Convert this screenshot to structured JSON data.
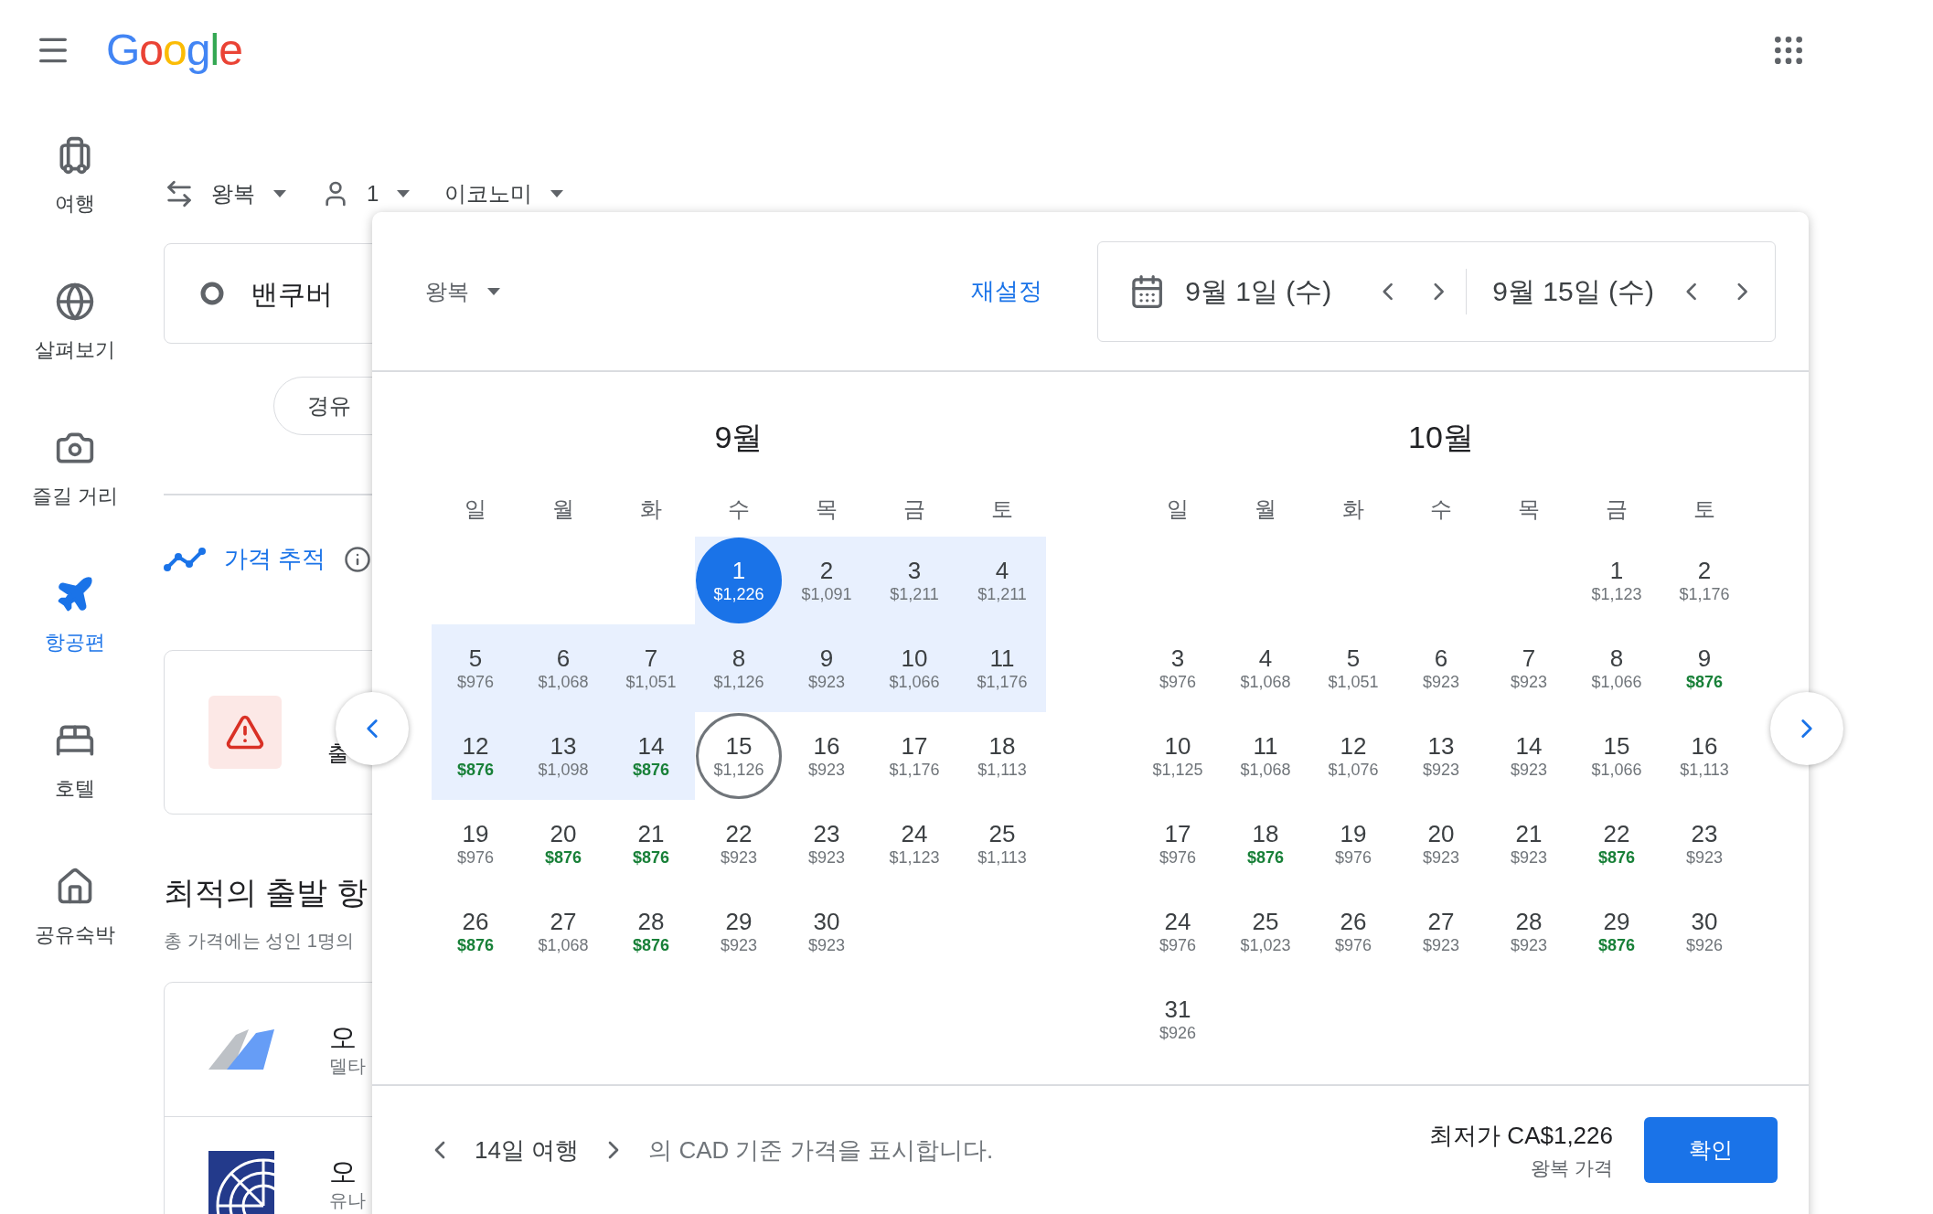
{
  "logo": "Google",
  "rail": [
    {
      "label": "여행",
      "selected": false
    },
    {
      "label": "살펴보기",
      "selected": false
    },
    {
      "label": "즐길 거리",
      "selected": false
    },
    {
      "label": "항공편",
      "selected": true
    },
    {
      "label": "호텔",
      "selected": false
    },
    {
      "label": "공유숙박",
      "selected": false
    }
  ],
  "trip_bar": {
    "trip_type": "왕복",
    "passengers": "1",
    "cabin": "이코노미"
  },
  "origin": "밴쿠버",
  "stops_chip": "경유",
  "price_tracking": "가격 추적",
  "alert_card": {
    "subtitle": "출"
  },
  "best_heading": "최적의 출발 항",
  "best_note": "총 가격에는 성인 1명의",
  "flights": [
    {
      "time": "오",
      "airline": "델타"
    },
    {
      "time": "오",
      "airline": "유나"
    }
  ],
  "picker": {
    "trip_type": "왕복",
    "reset": "재설정",
    "depart": "9월 1일 (수)",
    "return": "9월 15일 (수)",
    "months": [
      {
        "title": "9월",
        "weekdays": [
          "일",
          "월",
          "화",
          "수",
          "목",
          "금",
          "토"
        ],
        "weeks": [
          [
            {
              "day": "1",
              "price": "$1,226",
              "cheap": false,
              "selected": true,
              "in_range": true
            },
            {
              "day": "2",
              "price": "$1,091",
              "cheap": false,
              "selected": false,
              "in_range": true
            },
            {
              "day": "3",
              "price": "$1,211",
              "cheap": false,
              "selected": false,
              "in_range": true
            },
            {
              "day": "4",
              "price": "$1,211",
              "cheap": false,
              "selected": false,
              "in_range": true
            }
          ],
          [
            {
              "day": "5",
              "price": "$976",
              "cheap": false,
              "selected": false,
              "in_range": true
            },
            {
              "day": "6",
              "price": "$1,068",
              "cheap": false,
              "selected": false,
              "in_range": true
            },
            {
              "day": "7",
              "price": "$1,051",
              "cheap": false,
              "selected": false,
              "in_range": true
            },
            {
              "day": "8",
              "price": "$1,126",
              "cheap": false,
              "selected": false,
              "in_range": true
            },
            {
              "day": "9",
              "price": "$923",
              "cheap": false,
              "selected": false,
              "in_range": true
            },
            {
              "day": "10",
              "price": "$1,066",
              "cheap": false,
              "selected": false,
              "in_range": true
            },
            {
              "day": "11",
              "price": "$1,176",
              "cheap": false,
              "selected": false,
              "in_range": true
            }
          ],
          [
            {
              "day": "12",
              "price": "$876",
              "cheap": true,
              "selected": false,
              "in_range": true
            },
            {
              "day": "13",
              "price": "$1,098",
              "cheap": false,
              "selected": false,
              "in_range": true
            },
            {
              "day": "14",
              "price": "$876",
              "cheap": true,
              "selected": false,
              "in_range": true
            },
            {
              "day": "15",
              "price": "$1,126",
              "cheap": false,
              "selected": true,
              "in_range": false
            },
            {
              "day": "16",
              "price": "$923",
              "cheap": false,
              "selected": false,
              "in_range": false
            },
            {
              "day": "17",
              "price": "$1,176",
              "cheap": false,
              "selected": false,
              "in_range": false
            },
            {
              "day": "18",
              "price": "$1,113",
              "cheap": false,
              "selected": false,
              "in_range": false
            }
          ],
          [
            {
              "day": "19",
              "price": "$976",
              "cheap": false,
              "selected": false,
              "in_range": false
            },
            {
              "day": "20",
              "price": "$876",
              "cheap": true,
              "selected": false,
              "in_range": false
            },
            {
              "day": "21",
              "price": "$876",
              "cheap": true,
              "selected": false,
              "in_range": false
            },
            {
              "day": "22",
              "price": "$923",
              "cheap": false,
              "selected": false,
              "in_range": false
            },
            {
              "day": "23",
              "price": "$923",
              "cheap": false,
              "selected": false,
              "in_range": false
            },
            {
              "day": "24",
              "price": "$1,123",
              "cheap": false,
              "selected": false,
              "in_range": false
            },
            {
              "day": "25",
              "price": "$1,113",
              "cheap": false,
              "selected": false,
              "in_range": false
            }
          ],
          [
            {
              "day": "26",
              "price": "$876",
              "cheap": true,
              "selected": false,
              "in_range": false
            },
            {
              "day": "27",
              "price": "$1,068",
              "cheap": false,
              "selected": false,
              "in_range": false
            },
            {
              "day": "28",
              "price": "$876",
              "cheap": true,
              "selected": false,
              "in_range": false
            },
            {
              "day": "29",
              "price": "$923",
              "cheap": false,
              "selected": false,
              "in_range": false
            },
            {
              "day": "30",
              "price": "$923",
              "cheap": false,
              "selected": false,
              "in_range": false
            }
          ]
        ]
      },
      {
        "title": "10월",
        "weekdays": [
          "일",
          "월",
          "화",
          "수",
          "목",
          "금",
          "토"
        ],
        "weeks": [
          [
            {
              "day": "1",
              "price": "$1,123",
              "cheap": false,
              "selected": false,
              "in_range": false
            },
            {
              "day": "2",
              "price": "$1,176",
              "cheap": false,
              "selected": false,
              "in_range": false
            }
          ],
          [
            {
              "day": "3",
              "price": "$976",
              "cheap": false,
              "selected": false,
              "in_range": false
            },
            {
              "day": "4",
              "price": "$1,068",
              "cheap": false,
              "selected": false,
              "in_range": false
            },
            {
              "day": "5",
              "price": "$1,051",
              "cheap": false,
              "selected": false,
              "in_range": false
            },
            {
              "day": "6",
              "price": "$923",
              "cheap": false,
              "selected": false,
              "in_range": false
            },
            {
              "day": "7",
              "price": "$923",
              "cheap": false,
              "selected": false,
              "in_range": false
            },
            {
              "day": "8",
              "price": "$1,066",
              "cheap": false,
              "selected": false,
              "in_range": false
            },
            {
              "day": "9",
              "price": "$876",
              "cheap": true,
              "selected": false,
              "in_range": false
            }
          ],
          [
            {
              "day": "10",
              "price": "$1,125",
              "cheap": false,
              "selected": false,
              "in_range": false
            },
            {
              "day": "11",
              "price": "$1,068",
              "cheap": false,
              "selected": false,
              "in_range": false
            },
            {
              "day": "12",
              "price": "$1,076",
              "cheap": false,
              "selected": false,
              "in_range": false
            },
            {
              "day": "13",
              "price": "$923",
              "cheap": false,
              "selected": false,
              "in_range": false
            },
            {
              "day": "14",
              "price": "$923",
              "cheap": false,
              "selected": false,
              "in_range": false
            },
            {
              "day": "15",
              "price": "$1,066",
              "cheap": false,
              "selected": false,
              "in_range": false
            },
            {
              "day": "16",
              "price": "$1,113",
              "cheap": false,
              "selected": false,
              "in_range": false
            }
          ],
          [
            {
              "day": "17",
              "price": "$976",
              "cheap": false,
              "selected": false,
              "in_range": false
            },
            {
              "day": "18",
              "price": "$876",
              "cheap": true,
              "selected": false,
              "in_range": false
            },
            {
              "day": "19",
              "price": "$976",
              "cheap": false,
              "selected": false,
              "in_range": false
            },
            {
              "day": "20",
              "price": "$923",
              "cheap": false,
              "selected": false,
              "in_range": false
            },
            {
              "day": "21",
              "price": "$923",
              "cheap": false,
              "selected": false,
              "in_range": false
            },
            {
              "day": "22",
              "price": "$876",
              "cheap": true,
              "selected": false,
              "in_range": false
            },
            {
              "day": "23",
              "price": "$923",
              "cheap": false,
              "selected": false,
              "in_range": false
            }
          ],
          [
            {
              "day": "24",
              "price": "$976",
              "cheap": false,
              "selected": false,
              "in_range": false
            },
            {
              "day": "25",
              "price": "$1,023",
              "cheap": false,
              "selected": false,
              "in_range": false
            },
            {
              "day": "26",
              "price": "$976",
              "cheap": false,
              "selected": false,
              "in_range": false
            },
            {
              "day": "27",
              "price": "$923",
              "cheap": false,
              "selected": false,
              "in_range": false
            },
            {
              "day": "28",
              "price": "$923",
              "cheap": false,
              "selected": false,
              "in_range": false
            },
            {
              "day": "29",
              "price": "$876",
              "cheap": true,
              "selected": false,
              "in_range": false
            },
            {
              "day": "30",
              "price": "$926",
              "cheap": false,
              "selected": false,
              "in_range": false
            }
          ],
          [
            {
              "day": "31",
              "price": "$926",
              "cheap": false,
              "selected": false,
              "in_range": false
            }
          ]
        ]
      }
    ],
    "footer": {
      "trip_length": "14일 여행",
      "note": "의 CAD 기준 가격을 표시합니다.",
      "lowest": "최저가 CA$1,226",
      "lowest_sub": "왕복 가격",
      "confirm": "확인"
    }
  }
}
